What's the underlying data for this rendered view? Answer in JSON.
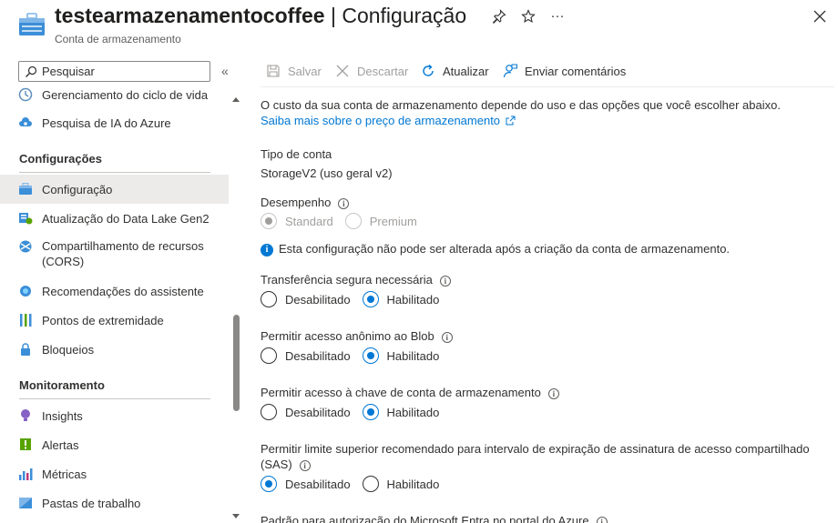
{
  "header": {
    "resource_name": "testearmazenamentocoffee",
    "separator": "|",
    "page_name": "Configuração",
    "subtitle": "Conta de armazenamento",
    "pin_icon": "pin-icon",
    "favorite_icon": "star-icon",
    "more_label": "···",
    "close_icon": "close-icon"
  },
  "sidebar": {
    "search": {
      "placeholder": "Pesquisar",
      "value": ""
    },
    "collapse_label": "«",
    "items_top": [
      {
        "label": "Gerenciamento do ciclo de vida",
        "icon": "lifecycle-icon"
      },
      {
        "label": "Pesquisa de IA do Azure",
        "icon": "cloud-search-icon"
      }
    ],
    "section_config": "Configurações",
    "items_config": [
      {
        "label": "Configuração",
        "icon": "storage-config-icon",
        "selected": true
      },
      {
        "label": "Atualização do Data Lake Gen2",
        "icon": "data-lake-icon"
      },
      {
        "label": "Compartilhamento de recursos (CORS)",
        "icon": "cors-icon"
      },
      {
        "label": "Recomendações do assistente",
        "icon": "advisor-icon"
      },
      {
        "label": "Pontos de extremidade",
        "icon": "endpoints-icon"
      },
      {
        "label": "Bloqueios",
        "icon": "lock-icon"
      }
    ],
    "section_monitor": "Monitoramento",
    "items_monitor": [
      {
        "label": "Insights",
        "icon": "insights-icon"
      },
      {
        "label": "Alertas",
        "icon": "alerts-icon"
      },
      {
        "label": "Métricas",
        "icon": "metrics-icon"
      },
      {
        "label": "Pastas de trabalho",
        "icon": "workbooks-icon"
      }
    ]
  },
  "toolbar": {
    "save_label": "Salvar",
    "discard_label": "Descartar",
    "refresh_label": "Atualizar",
    "feedback_label": "Enviar comentários"
  },
  "content": {
    "intro": "O custo da sua conta de armazenamento depende do uso e das opções que você escolher abaixo.",
    "pricing_link": "Saiba mais sobre o preço de armazenamento",
    "account_type_label": "Tipo de conta",
    "account_type_value": "StorageV2 (uso geral v2)",
    "performance_label": "Desempenho",
    "performance_options": [
      "Standard",
      "Premium"
    ],
    "performance_note": "Esta configuração não pode ser alterada após a criação da conta de armazenamento.",
    "secure_transfer_label": "Transferência segura necessária",
    "anon_blob_label": "Permitir acesso anônimo ao Blob",
    "key_access_label": "Permitir acesso à chave de conta de armazenamento",
    "sas_label_line1": "Permitir limite superior recomendado para intervalo de expiração de assinatura de acesso compartilhado",
    "sas_label_line2": "(SAS)",
    "entra_label": "Padrão para autorização do Microsoft Entra no portal do Azure",
    "disabled_option": "Desabilitado",
    "enabled_option": "Habilitado",
    "secure_transfer_value": "Habilitado",
    "anon_blob_value": "Habilitado",
    "key_access_value": "Habilitado",
    "sas_value": "Desabilitado",
    "performance_value": "Standard"
  },
  "colors": {
    "accent": "#0078d4",
    "selected_bg": "#edebe9",
    "text": "#323130",
    "disabled": "#a19f9d"
  }
}
